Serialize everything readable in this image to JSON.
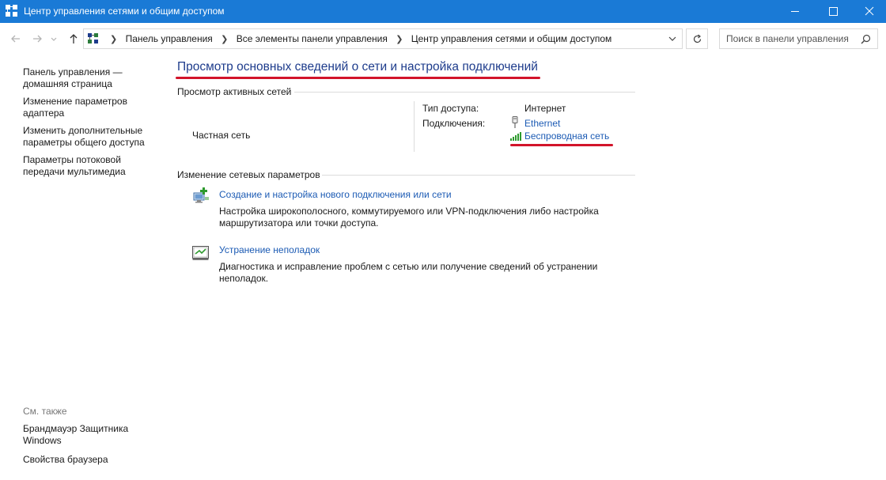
{
  "window": {
    "title": "Центр управления сетями и общим доступом"
  },
  "address": {
    "crumbs": [
      "Панель управления",
      "Все элементы панели управления",
      "Центр управления сетями и общим доступом"
    ]
  },
  "search": {
    "placeholder": "Поиск в панели управления"
  },
  "sidebar": {
    "items": [
      {
        "label": "Панель управления — домашняя страница"
      },
      {
        "label": "Изменение параметров адаптера"
      },
      {
        "label": "Изменить дополнительные параметры общего доступа"
      },
      {
        "label": "Параметры потоковой передачи мультимедиа"
      }
    ],
    "see_also": {
      "header": "См. также",
      "items": [
        {
          "label": "Брандмауэр Защитника Windows"
        },
        {
          "label": "Свойства браузера"
        }
      ]
    }
  },
  "main": {
    "title": "Просмотр основных сведений о сети и настройка подключений",
    "active_networks": {
      "header": "Просмотр активных сетей",
      "network_name": "Частная сеть",
      "access_type_label": "Тип доступа:",
      "access_type_value": "Интернет",
      "connections_label": "Подключения:",
      "connections": [
        "Ethernet",
        "Беспроводная сеть"
      ]
    },
    "change_settings": {
      "header": "Изменение сетевых параметров",
      "items": [
        {
          "title": "Создание и настройка нового подключения или сети",
          "description": "Настройка широкополосного, коммутируемого или VPN-подключения либо настройка маршрутизатора или точки доступа."
        },
        {
          "title": "Устранение неполадок",
          "description": "Диагностика и исправление проблем с сетью или получение сведений об устранении неполадок."
        }
      ]
    }
  },
  "colors": {
    "titlebar": "#1a7ad6",
    "link": "#1c5bb4",
    "heading": "#1e3c8c",
    "highlight": "#d2142a"
  }
}
